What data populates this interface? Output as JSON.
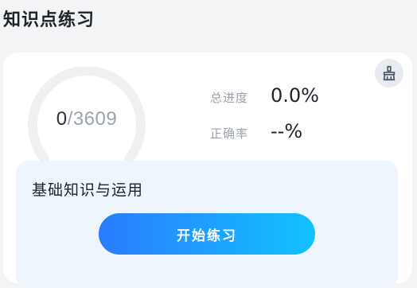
{
  "page": {
    "title": "知识点练习"
  },
  "progress_card": {
    "gauge": {
      "done": "0",
      "separator": "/",
      "total": "3609",
      "fill_fraction": 0.0
    },
    "stats": [
      {
        "label": "总进度",
        "value": "0.0%"
      },
      {
        "label": "正确率",
        "value": "--%"
      }
    ],
    "clean_icon": "broom-icon"
  },
  "module": {
    "title": "基础知识与运用",
    "start_label": "开始练习"
  },
  "colors": {
    "accent_start": "#2a7cff",
    "accent_end": "#12c2ff",
    "gauge_track": "#eef0f2",
    "module_bg": "#eef5fd"
  }
}
